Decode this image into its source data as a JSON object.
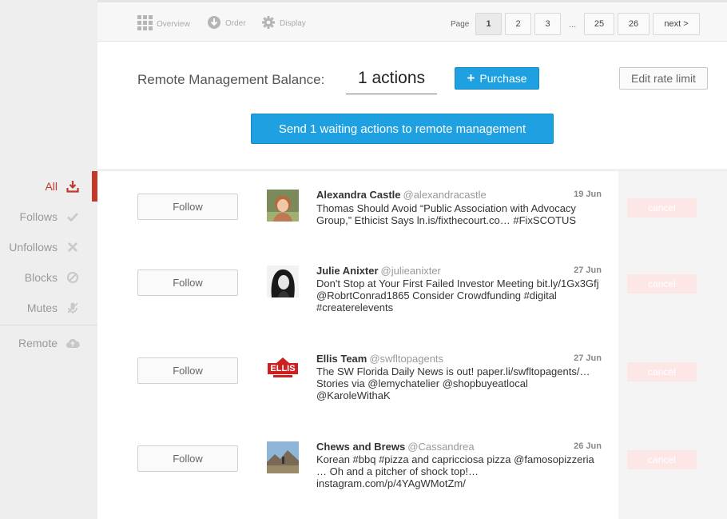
{
  "sidebar": {
    "items": [
      {
        "label": "All",
        "icon": "download-icon",
        "active": true
      },
      {
        "label": "Follows",
        "icon": "check-icon"
      },
      {
        "label": "Unfollows",
        "icon": "x-icon"
      },
      {
        "label": "Blocks",
        "icon": "block-icon"
      },
      {
        "label": "Mutes",
        "icon": "mute-icon"
      },
      {
        "label": "Remote",
        "icon": "cloud-icon"
      }
    ]
  },
  "toolbar": {
    "overview_label": "Overview",
    "order_label": "Order",
    "display_label": "Display"
  },
  "pagination": {
    "label": "Page",
    "pages": [
      "1",
      "2",
      "3",
      "25",
      "26"
    ],
    "ellipsis": "...",
    "next_label": "next >",
    "current": "1"
  },
  "balance": {
    "label": "Remote Management Balance:",
    "value": "1 actions",
    "purchase_label": "Purchase",
    "edit_rate_label": "Edit rate limit",
    "send_label": "Send 1 waiting actions to remote management"
  },
  "actions": [
    {
      "follow_label": "Follow",
      "name": "Alexandra Castle",
      "handle": "@alexandracastle",
      "date": "19 Jun",
      "text": "Thomas Should Avoid “Public Association with Advocacy Group,” Ethicist Says ln.is/fixthecourt.co… #FixSCOTUS",
      "cancel_label": "cancel"
    },
    {
      "follow_label": "Follow",
      "name": "Julie Anixter",
      "handle": "@julieanixter",
      "date": "27 Jun",
      "text": "Don't Stop at Your First Failed Investor Meeting bit.ly/1Gx3Gfj @RobrtConrad1865 Consider Crowdfunding #digital #createrelevents",
      "cancel_label": "cancel"
    },
    {
      "follow_label": "Follow",
      "name": "Ellis Team",
      "handle": "@swfltopagents",
      "date": "27 Jun",
      "text": "The SW Florida Daily News is out! paper.li/swfltopagents/… Stories via @lemychatelier @shopbuyeatlocal @KaroleWithaK",
      "avatar_text": "ELLIS",
      "cancel_label": "cancel"
    },
    {
      "follow_label": "Follow",
      "name": "Chews and Brews",
      "handle": "@Cassandrea",
      "date": "26 Jun",
      "text": "Korean #bbq #pizza and capricciosa pizza @famosopizzeria … Oh and a pitcher of shock top!… instagram.com/p/4YAgWMotZm/",
      "cancel_label": "cancel"
    }
  ],
  "colors": {
    "accent_red": "#c0392b",
    "button_blue": "#1fa0e0"
  }
}
